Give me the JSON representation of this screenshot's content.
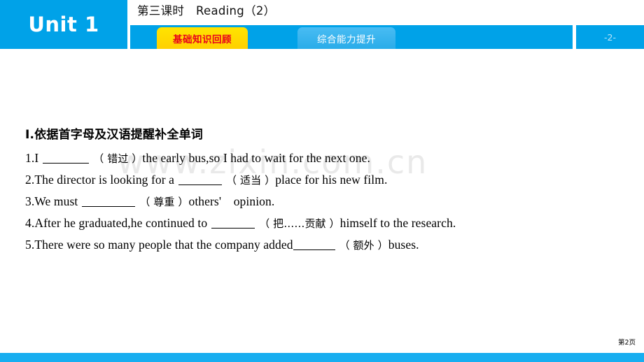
{
  "header": {
    "unit_label": "Unit 1",
    "lesson_title": "第三课时　Reading（2）",
    "page_indicator": "-2-",
    "tabs": [
      {
        "label": "基础知识回顾",
        "state": "active"
      },
      {
        "label": "综合能力提升",
        "state": "inactive"
      }
    ],
    "colors": {
      "brand_blue": "#00A2E8",
      "active_tab_bg": "#FFE400",
      "active_tab_text": "#E8001C",
      "inactive_tab_bg": "#29ACE9",
      "inactive_tab_text": "#FFFFFF",
      "page_indicator_text": "#BFE6FA"
    }
  },
  "watermark": {
    "text": "www.zixin.com.cn",
    "color": "#E9E9E9"
  },
  "main": {
    "section_heading": "Ⅰ.依据首字母及汉语提醒补全单词",
    "questions": [
      {
        "number": "1.",
        "pre": "I",
        "hint": "（ 错过 ）",
        "post": "the early bus,so I had to wait for the next one.",
        "blank_width": 66
      },
      {
        "number": "2.",
        "pre": "The director is looking for a",
        "hint": "（ 适当 ）",
        "post": "place for his new film.",
        "blank_width": 62
      },
      {
        "number": "3.",
        "pre": "We must",
        "hint": "（ 尊重 ）",
        "post": "others'　opinion.",
        "blank_width": 76
      },
      {
        "number": "4.",
        "pre": "After he graduated,he continued to",
        "hint": "（ 把……贡献 ）",
        "post": "himself to the research.",
        "blank_width": 62
      },
      {
        "number": "5.",
        "pre": "There were so many people that the company added",
        "hint": "（ 额外 ）",
        "post": "buses.",
        "blank_width": 60
      }
    ]
  },
  "footer": {
    "page_label": "第2页",
    "bar_color": "#18AEF0"
  }
}
